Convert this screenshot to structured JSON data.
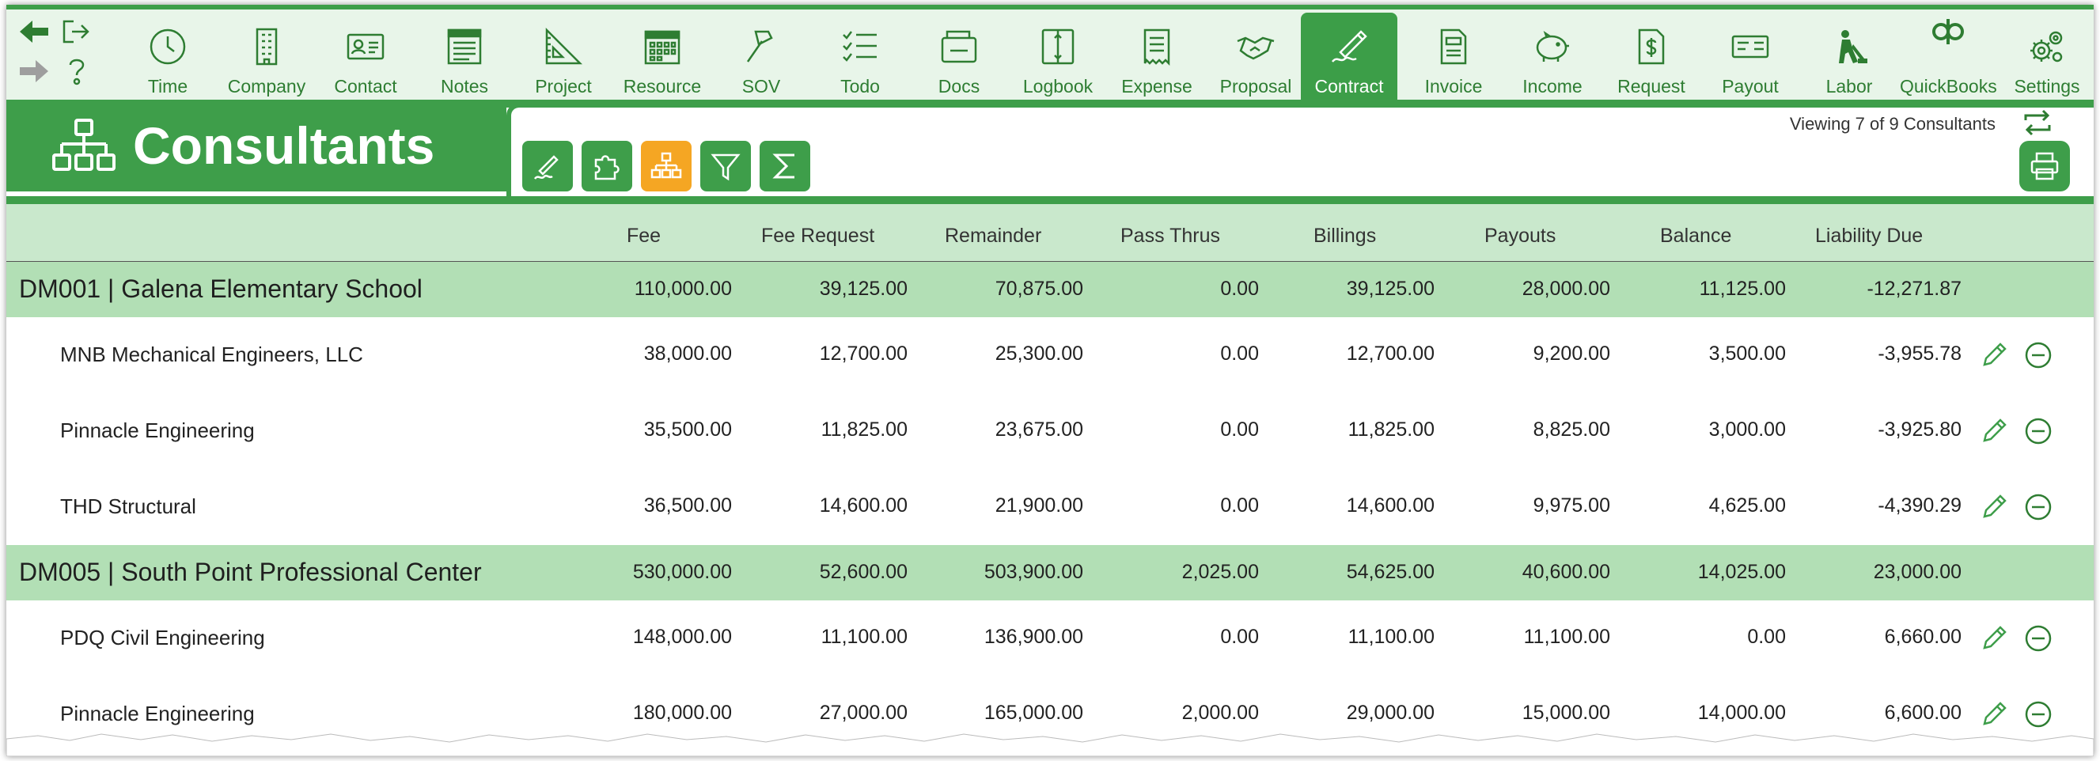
{
  "toolbar": {
    "tools": [
      {
        "label": "Time",
        "icon": "clock-icon"
      },
      {
        "label": "Company",
        "icon": "building-icon"
      },
      {
        "label": "Contact",
        "icon": "contact-card-icon"
      },
      {
        "label": "Notes",
        "icon": "notes-icon"
      },
      {
        "label": "Project",
        "icon": "triangle-ruler-icon"
      },
      {
        "label": "Resource",
        "icon": "calendar-grid-icon"
      },
      {
        "label": "SOV",
        "icon": "gavel-icon"
      },
      {
        "label": "Todo",
        "icon": "checklist-icon"
      },
      {
        "label": "Docs",
        "icon": "documents-icon"
      },
      {
        "label": "Logbook",
        "icon": "logbook-icon"
      },
      {
        "label": "Expense",
        "icon": "receipt-icon"
      },
      {
        "label": "Proposal",
        "icon": "handshake-icon"
      },
      {
        "label": "Contract",
        "icon": "pen-signature-icon"
      },
      {
        "label": "Invoice",
        "icon": "invoice-icon"
      },
      {
        "label": "Income",
        "icon": "piggy-bank-icon"
      },
      {
        "label": "Request",
        "icon": "dollar-document-icon"
      },
      {
        "label": "Payout",
        "icon": "check-payment-icon"
      },
      {
        "label": "Labor",
        "icon": "worker-icon"
      },
      {
        "label": "QuickBooks",
        "icon": "quickbooks-icon"
      },
      {
        "label": "Settings",
        "icon": "gears-icon"
      }
    ],
    "active": "Contract"
  },
  "header": {
    "title": "Consultants",
    "viewing": "Viewing 7 of 9 Consultants"
  },
  "colors": {
    "green": "#3e9e4a",
    "light_green": "#e8f5e9",
    "group_row": "#b2dfb5",
    "header_row": "#c9e8cc",
    "orange": "#f5a623"
  },
  "columns": [
    "Fee",
    "Fee Request",
    "Remainder",
    "Pass Thrus",
    "Billings",
    "Payouts",
    "Balance",
    "Liability Due"
  ],
  "rows": [
    {
      "type": "group",
      "name": "DM001 | Galena Elementary School",
      "values": [
        "110,000.00",
        "39,125.00",
        "70,875.00",
        "0.00",
        "39,125.00",
        "28,000.00",
        "11,125.00",
        "-12,271.87"
      ]
    },
    {
      "type": "child",
      "name": "MNB Mechanical Engineers, LLC",
      "values": [
        "38,000.00",
        "12,700.00",
        "25,300.00",
        "0.00",
        "12,700.00",
        "9,200.00",
        "3,500.00",
        "-3,955.78"
      ]
    },
    {
      "type": "child",
      "name": "Pinnacle Engineering",
      "values": [
        "35,500.00",
        "11,825.00",
        "23,675.00",
        "0.00",
        "11,825.00",
        "8,825.00",
        "3,000.00",
        "-3,925.80"
      ]
    },
    {
      "type": "child",
      "name": "THD Structural",
      "values": [
        "36,500.00",
        "14,600.00",
        "21,900.00",
        "0.00",
        "14,600.00",
        "9,975.00",
        "4,625.00",
        "-4,390.29"
      ]
    },
    {
      "type": "group",
      "name": "DM005 | South Point Professional Center",
      "values": [
        "530,000.00",
        "52,600.00",
        "503,900.00",
        "2,025.00",
        "54,625.00",
        "40,600.00",
        "14,025.00",
        "23,000.00"
      ]
    },
    {
      "type": "child",
      "name": "PDQ Civil Engineering",
      "values": [
        "148,000.00",
        "11,100.00",
        "136,900.00",
        "0.00",
        "11,100.00",
        "11,100.00",
        "0.00",
        "6,660.00"
      ]
    },
    {
      "type": "child",
      "name": "Pinnacle Engineering",
      "values": [
        "180,000.00",
        "27,000.00",
        "165,000.00",
        "2,000.00",
        "29,000.00",
        "15,000.00",
        "14,000.00",
        "6,600.00"
      ]
    }
  ]
}
